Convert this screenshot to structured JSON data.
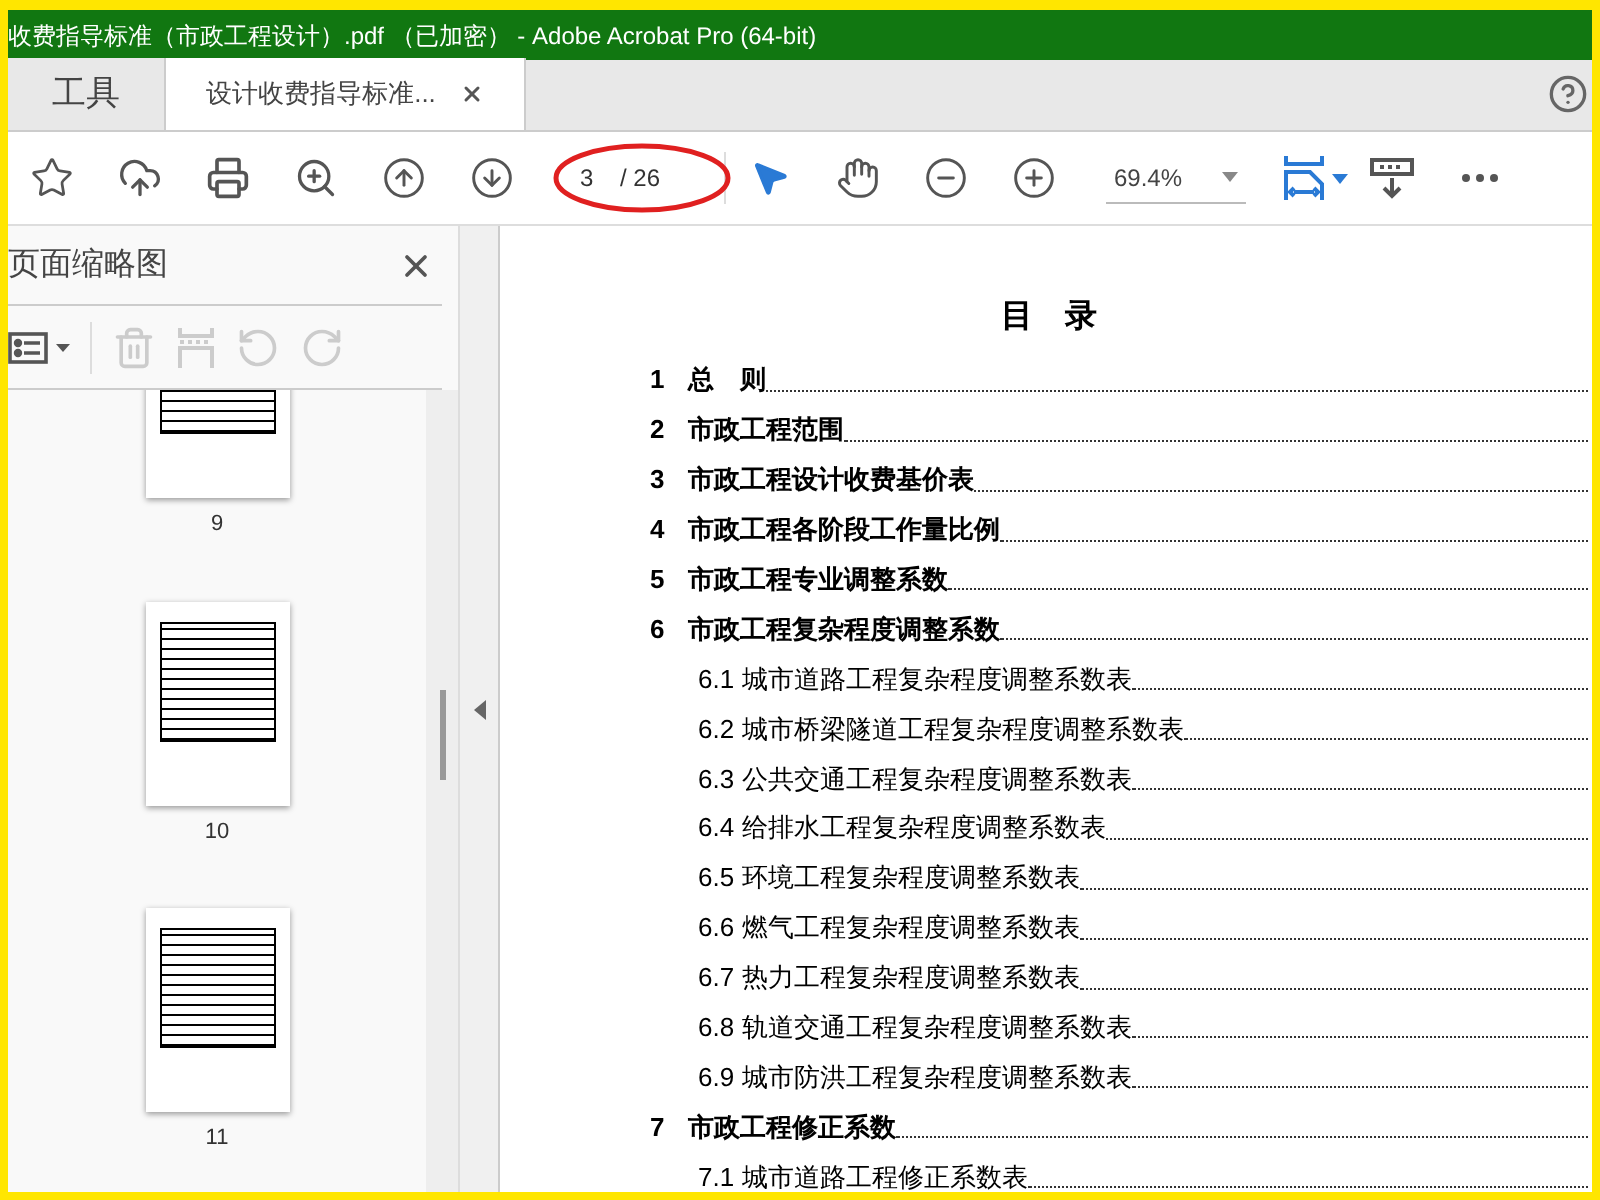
{
  "window": {
    "title": "收费指导标准（市政工程设计）.pdf （已加密） - Adobe Acrobat Pro (64-bit)"
  },
  "tabs": [
    {
      "label": "工具",
      "selected": false
    },
    {
      "label": "设计收费指导标准...",
      "selected": true
    }
  ],
  "toolbar": {
    "page_value": "3",
    "page_total": "/ 26",
    "zoom": "69.4%"
  },
  "sidebar": {
    "title": "页面缩略图",
    "thumbnails": [
      {
        "label": "9"
      },
      {
        "label": "10"
      },
      {
        "label": "11"
      }
    ]
  },
  "toc": {
    "title": "目　录",
    "entries": [
      {
        "num": "1",
        "text": "总　则"
      },
      {
        "num": "2",
        "text": "市政工程范围"
      },
      {
        "num": "3",
        "text": "市政工程设计收费基价表"
      },
      {
        "num": "4",
        "text": "市政工程各阶段工作量比例"
      },
      {
        "num": "5",
        "text": "市政工程专业调整系数"
      },
      {
        "num": "6",
        "text": "市政工程复杂程度调整系数",
        "children": [
          {
            "num": "6.1",
            "text": "城市道路工程复杂程度调整系数表"
          },
          {
            "num": "6.2",
            "text": "城市桥梁隧道工程复杂程度调整系数表"
          },
          {
            "num": "6.3",
            "text": "公共交通工程复杂程度调整系数表"
          },
          {
            "num": "6.4",
            "text": "给排水工程复杂程度调整系数表"
          },
          {
            "num": "6.5",
            "text": "环境工程复杂程度调整系数表"
          },
          {
            "num": "6.6",
            "text": "燃气工程复杂程度调整系数表"
          },
          {
            "num": "6.7",
            "text": "热力工程复杂程度调整系数表"
          },
          {
            "num": "6.8",
            "text": "轨道交通工程复杂程度调整系数表"
          },
          {
            "num": "6.9",
            "text": "城市防洪工程复杂程度调整系数表"
          }
        ]
      },
      {
        "num": "7",
        "text": "市政工程修正系数",
        "children": [
          {
            "num": "7.1",
            "text": "城市道路工程修正系数表"
          }
        ]
      }
    ]
  }
}
